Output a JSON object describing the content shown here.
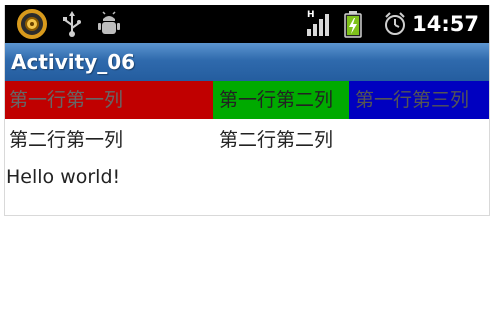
{
  "status_bar": {
    "time": "14:57",
    "icons": [
      "app-notification-icon",
      "usb-icon",
      "debug-icon",
      "signal-h-icon",
      "battery-charging-icon",
      "alarm-icon"
    ],
    "network_label": "H"
  },
  "title_bar": {
    "title": "Activity_06"
  },
  "table": {
    "rows": [
      {
        "cells": [
          {
            "text": "第一行第一列",
            "bg": "#c00000",
            "color": "#666666"
          },
          {
            "text": "第一行第二列",
            "bg": "#00aa00",
            "color": "#222222"
          },
          {
            "text": "第一行第三列",
            "bg": "#0000c0",
            "color": "#555555"
          }
        ]
      },
      {
        "cells": [
          {
            "text": "第二行第一列",
            "bg": "#ffffff",
            "color": "#222222"
          },
          {
            "text": "第二行第二列",
            "bg": "#ffffff",
            "color": "#222222"
          }
        ]
      }
    ]
  },
  "content": {
    "hello": "Hello world!"
  },
  "colors": {
    "status_bar": "#000000",
    "title_bar": "#2f6aad",
    "title_text": "#ffffff",
    "body_text": "#222222"
  }
}
